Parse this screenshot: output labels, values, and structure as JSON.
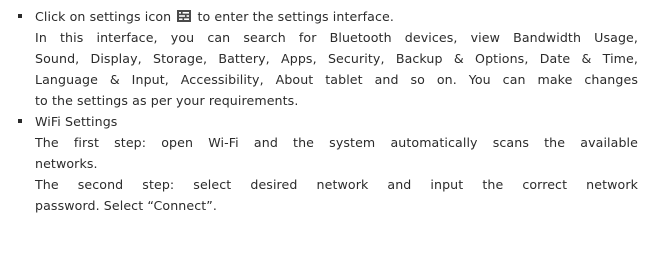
{
  "sections": [
    {
      "first_line_before_icon": "Click on settings icon",
      "icon": "settings-icon",
      "first_line_after_icon": "to enter the settings interface.",
      "lines": [
        "In this interface, you can search for Bluetooth devices, view Bandwidth Usage,",
        "Sound, Display, Storage, Battery, Apps, Security, Backup & Options, Date & Time,",
        "Language & Input, Accessibility, About tablet and so on. You can make changes",
        "to the settings as per your requirements."
      ]
    },
    {
      "heading": "WiFi Settings",
      "lines": [
        "The first step: open Wi-Fi and the system automatically scans the available",
        "networks.",
        "The second step: select desired network and input the correct network",
        "password. Select “Connect”."
      ]
    }
  ]
}
